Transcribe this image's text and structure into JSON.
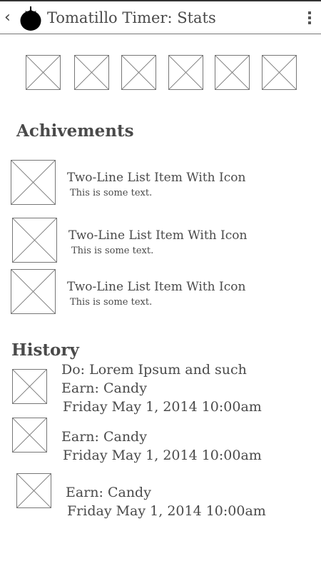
{
  "header": {
    "back_glyph": "‹",
    "title": "Tomatillo Timer: Stats",
    "logo_icon": "tomato-icon",
    "menu_icon": "more-vert-icon"
  },
  "icon_row": [
    "image-placeholder",
    "image-placeholder",
    "image-placeholder",
    "image-placeholder",
    "image-placeholder",
    "image-placeholder"
  ],
  "achievements": {
    "heading": "Achivements",
    "items": [
      {
        "primary": "Two-Line List Item With Icon",
        "secondary": "This is some text."
      },
      {
        "primary": "Two-Line List Item With Icon",
        "secondary": "This is some text."
      },
      {
        "primary": "Two-Line List Item With Icon",
        "secondary": "This is some text."
      }
    ]
  },
  "history": {
    "heading": "History",
    "entries": [
      {
        "task": "Do: Lorem Ipsum and such",
        "earn": "Earn: Candy",
        "date": "Friday May 1, 2014 10:00am"
      },
      {
        "earn": "Earn: Candy",
        "date": "Friday May 1, 2014 10:00am"
      },
      {
        "earn": "Earn: Candy",
        "date": "Friday May 1, 2014 10:00am"
      }
    ]
  }
}
